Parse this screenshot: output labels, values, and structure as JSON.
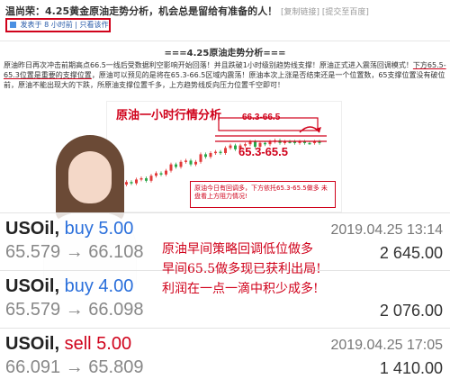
{
  "header": {
    "title": "温尚荣：4.25黄金原油走势分析，机会总是留给有准备的人！",
    "title_tag": "[复制链接] [提交至百度]",
    "meta": "发表于 8 小时前 | 只看该作者 ▶"
  },
  "section_title": "===4.25原油走势分析===",
  "article": {
    "p1a": "原油昨日再次冲击前期高点66.5一线后受数据利空影响开始回落！并且跌破1小时级别趋势线支撑！原油正式进入震荡回调模式！",
    "p1b": "下方65.5-65.3位置是重要的支撑位置",
    "p1c": "，原油可以预见的是将在65.3-66.5区域内震荡！原油本次上涨是否结束还是一个位置数，65支撑位置没有破位前，原油不能出现大的下跌，所原油支撑位置千多，上方趋势线反向压力位置千空即可！"
  },
  "chart": {
    "title": "原油一小时行情分析",
    "upper_zone": "66.3-66.5",
    "lower_zone": "65.3-65.5",
    "note": "原油今日有回调多，下方依托65.3-65.5做多 未盘看上方阻力情况!",
    "accent_color": "#d0021b"
  },
  "trades": [
    {
      "symbol": "USOil,",
      "side": "buy",
      "lots": "5.00",
      "open": "65.579",
      "arrow": "→",
      "close": "66.108",
      "date": "2019.04.25 13:14",
      "profit": "2 645.00"
    },
    {
      "symbol": "USOil,",
      "side": "buy",
      "lots": "4.00",
      "open": "65.579",
      "arrow": "→",
      "close": "66.098",
      "date": "",
      "profit": "2 076.00"
    },
    {
      "symbol": "USOil,",
      "side": "sell",
      "lots": "5.00",
      "open": "66.091",
      "arrow": "→",
      "close": "65.809",
      "date": "2019.04.25 17:05",
      "profit": "1 410.00"
    }
  ],
  "overlay": {
    "line1": "原油早间策略回调低位做多",
    "line2": "早间65.5做多现已获利出局!",
    "line3": "利润在一点一滴中积少成多!"
  }
}
